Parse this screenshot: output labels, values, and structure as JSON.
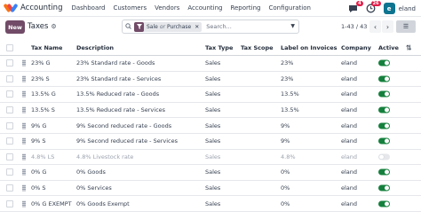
{
  "navbar": {
    "app_name": "Accounting",
    "menu": [
      "Dashboard",
      "Customers",
      "Vendors",
      "Accounting",
      "Reporting",
      "Configuration"
    ],
    "chat_badge": "4",
    "activity_badge": "26",
    "avatar_letter": "e",
    "username": "eland"
  },
  "control": {
    "new_label": "New",
    "breadcrumb": "Taxes",
    "facet_a": "Sale",
    "facet_or": "or",
    "facet_b": "Purchase",
    "search_placeholder": "Search...",
    "pager": "1-43 / 43"
  },
  "columns": [
    "Tax Name",
    "Description",
    "Tax Type",
    "Tax Scope",
    "Label on Invoices",
    "Company",
    "Active"
  ],
  "rows": [
    {
      "name": "23% G",
      "desc": "23% Standard rate - Goods",
      "type": "Sales",
      "scope": "",
      "label": "23%",
      "company": "eland",
      "active": true
    },
    {
      "name": "23% S",
      "desc": "23% Standard rate - Services",
      "type": "Sales",
      "scope": "",
      "label": "23%",
      "company": "eland",
      "active": true
    },
    {
      "name": "13.5% G",
      "desc": "13.5% Reduced rate - Goods",
      "type": "Sales",
      "scope": "",
      "label": "13.5%",
      "company": "eland",
      "active": true
    },
    {
      "name": "13.5% S",
      "desc": "13.5% Reduced rate - Services",
      "type": "Sales",
      "scope": "",
      "label": "13.5%",
      "company": "eland",
      "active": true
    },
    {
      "name": "9% G",
      "desc": "9% Second reduced rate - Goods",
      "type": "Sales",
      "scope": "",
      "label": "9%",
      "company": "eland",
      "active": true
    },
    {
      "name": "9% S",
      "desc": "9% Second reduced rate - Services",
      "type": "Sales",
      "scope": "",
      "label": "9%",
      "company": "eland",
      "active": true
    },
    {
      "name": "4.8% LS",
      "desc": "4.8% Livestock rate",
      "type": "Sales",
      "scope": "",
      "label": "4.8%",
      "company": "eland",
      "active": false
    },
    {
      "name": "0% G",
      "desc": "0% Goods",
      "type": "Sales",
      "scope": "",
      "label": "0%",
      "company": "eland",
      "active": true
    },
    {
      "name": "0% S",
      "desc": "0% Services",
      "type": "Sales",
      "scope": "",
      "label": "0%",
      "company": "eland",
      "active": true
    },
    {
      "name": "0% G EXEMPT",
      "desc": "0% Goods Exempt",
      "type": "Sales",
      "scope": "",
      "label": "0%",
      "company": "eland",
      "active": true
    }
  ],
  "colors": {
    "brand": "#714b67",
    "toggle_on": "#15803d",
    "badge": "#e11d48"
  }
}
